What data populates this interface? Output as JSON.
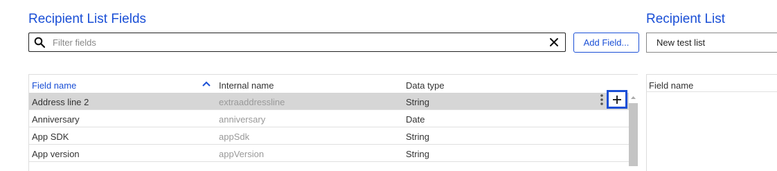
{
  "left_panel": {
    "title": "Recipient List Fields",
    "filter": {
      "placeholder": "Filter fields",
      "value": ""
    },
    "add_button_label": "Add Field...",
    "table": {
      "columns": {
        "field_name": "Field name",
        "internal_name": "Internal name",
        "data_type": "Data type"
      },
      "sort": "ascending",
      "rows": [
        {
          "field_name": "Address line 2",
          "internal_name": "extraaddressline",
          "data_type": "String",
          "selected": true
        },
        {
          "field_name": "Anniversary",
          "internal_name": "anniversary",
          "data_type": "Date"
        },
        {
          "field_name": "App SDK",
          "internal_name": "appSdk",
          "data_type": "String"
        },
        {
          "field_name": "App version",
          "internal_name": "appVersion",
          "data_type": "String"
        }
      ]
    }
  },
  "right_panel": {
    "title": "Recipient List",
    "selected_list": "New test list",
    "table": {
      "columns": {
        "field_name": "Field name"
      }
    }
  },
  "colors": {
    "accent": "#1a4fd6",
    "selected_row": "#d6d6d6",
    "muted_text": "#999999"
  },
  "icons": [
    "search-icon",
    "clear-icon",
    "sort-ascending-icon",
    "kebab-menu-icon",
    "plus-icon",
    "scroll-up-icon"
  ]
}
